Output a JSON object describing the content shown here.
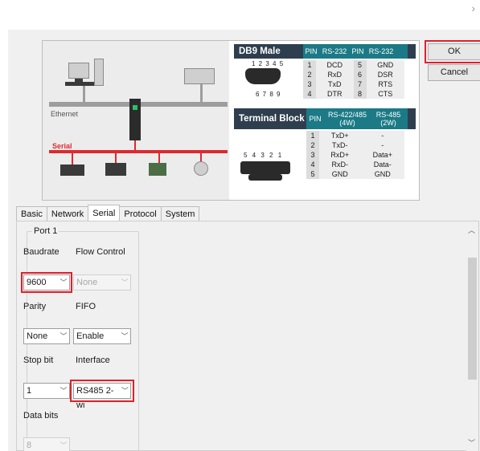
{
  "window": {
    "corner_icon": "chevron-right-icon"
  },
  "buttons": {
    "ok": "OK",
    "cancel": "Cancel"
  },
  "illustration": {
    "ethernet_label": "Ethernet",
    "serial_label": "Serial",
    "db9": {
      "title": "DB9 Male",
      "pin_numbers_top": "1 2 3 4 5",
      "pin_numbers_bottom": "6 7 8 9",
      "headers": [
        "PIN",
        "RS-232",
        "PIN",
        "RS-232"
      ],
      "rows": [
        [
          "1",
          "DCD",
          "5",
          "GND"
        ],
        [
          "2",
          "RxD",
          "6",
          "DSR"
        ],
        [
          "3",
          "TxD",
          "7",
          "RTS"
        ],
        [
          "4",
          "DTR",
          "8",
          "CTS"
        ]
      ]
    },
    "terminal": {
      "title": "Terminal Block",
      "pin_numbers": "5 4 3 2 1",
      "headers": [
        "PIN",
        "RS-422/485 (4W)",
        "RS-485 (2W)"
      ],
      "rows": [
        [
          "1",
          "TxD+",
          "-"
        ],
        [
          "2",
          "TxD-",
          "-"
        ],
        [
          "3",
          "RxD+",
          "Data+"
        ],
        [
          "4",
          "RxD-",
          "Data-"
        ],
        [
          "5",
          "GND",
          "GND"
        ]
      ]
    }
  },
  "tabs": [
    "Basic",
    "Network",
    "Serial",
    "Protocol",
    "System"
  ],
  "active_tab": "Serial",
  "port": {
    "legend": "Port 1",
    "baudrate": {
      "label": "Baudrate",
      "value": "9600"
    },
    "flow_control": {
      "label": "Flow Control",
      "value": "None"
    },
    "parity": {
      "label": "Parity",
      "value": "None"
    },
    "fifo": {
      "label": "FIFO",
      "value": "Enable"
    },
    "stop_bit": {
      "label": "Stop bit",
      "value": "1"
    },
    "interface": {
      "label": "Interface",
      "value": "RS485 2-wi"
    },
    "data_bits": {
      "label": "Data bits",
      "value": "8"
    }
  },
  "colors": {
    "highlight": "#e0202a",
    "serial_line": "#e0282f",
    "pin_header": "#1b7a86",
    "title_bar": "#2f3e4e"
  }
}
